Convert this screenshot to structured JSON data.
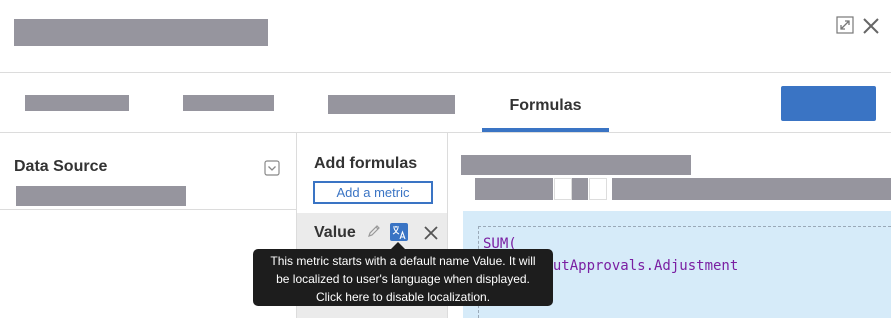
{
  "tabs": {
    "formulas_label": "Formulas"
  },
  "data_source": {
    "title": "Data Source"
  },
  "formulas_panel": {
    "title": "Add formulas",
    "add_metric_label": "Add a metric"
  },
  "metric": {
    "name": "Value"
  },
  "editor": {
    "line1": "SUM(",
    "line2_visible": "youtApprovals.Adjustment"
  },
  "tooltip": {
    "line1": "This metric starts with a default name Value. It will",
    "line2": "be localized to user's language when displayed.",
    "line3": "Click here to disable localization."
  },
  "icons": {
    "expand": "expand-icon",
    "close": "close-icon",
    "dropdown": "dropdown-toggle-icon",
    "edit": "pencil-icon",
    "translate": "translate-icon",
    "remove": "x-icon"
  },
  "colors": {
    "accent": "#3a74c4",
    "redaction": "#96959e",
    "editor_bg": "#d6ebf9",
    "tooltip_bg": "#1d1d1d",
    "code_keyword": "#7a1fa2"
  }
}
